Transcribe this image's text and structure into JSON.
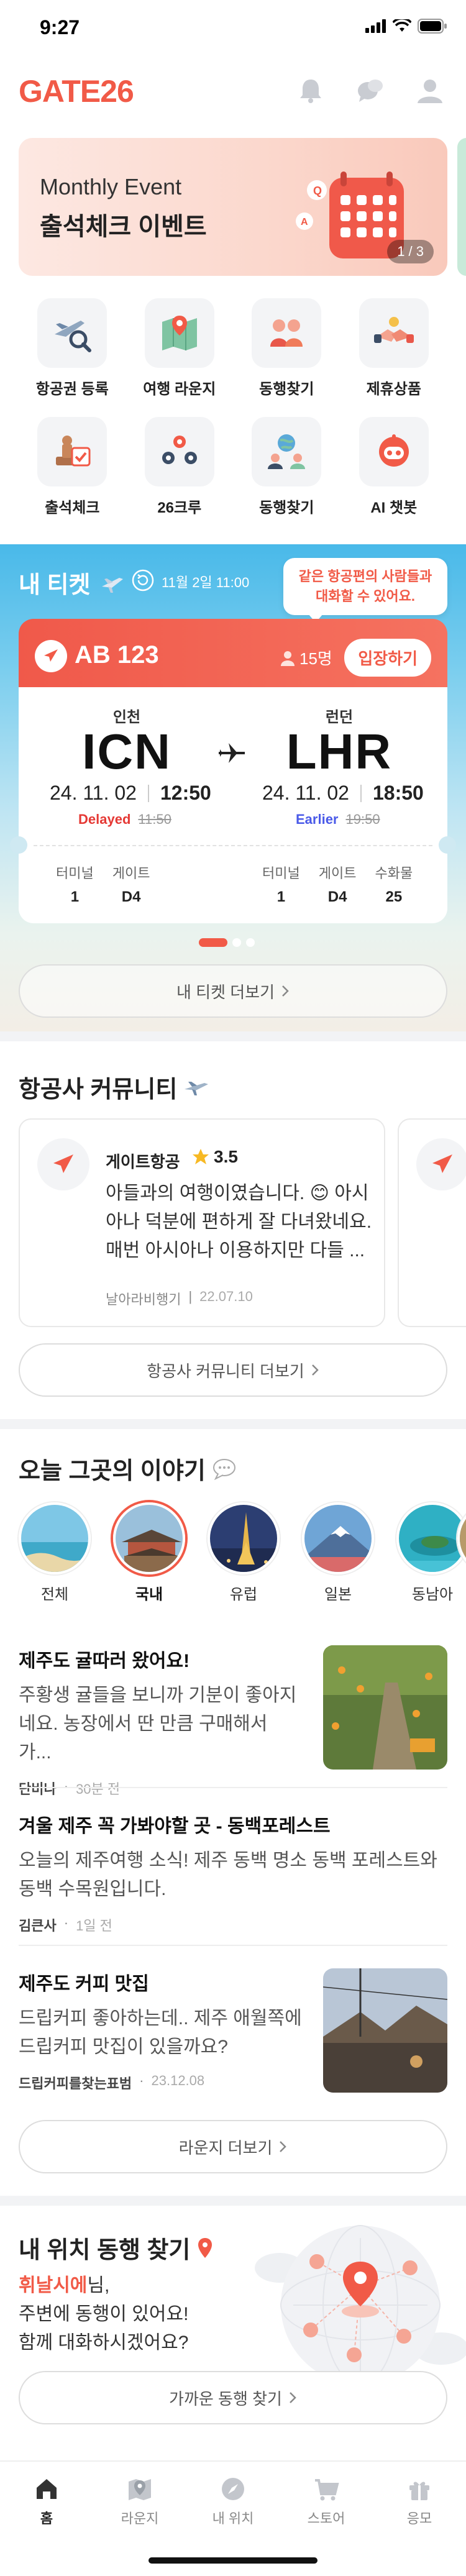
{
  "status_bar": {
    "time": "9:27"
  },
  "header": {
    "logo": "GATE26",
    "icons": [
      "bell-icon",
      "chat-icon",
      "profile-icon"
    ]
  },
  "banner": {
    "subtitle": "Monthly Event",
    "title": "출석체크 이벤트",
    "page": "1 / 3"
  },
  "quick_menu": [
    {
      "label": "항공권 등록",
      "icon": "plane-search-icon"
    },
    {
      "label": "여행 라운지",
      "icon": "map-icon"
    },
    {
      "label": "동행찾기",
      "icon": "people-icon"
    },
    {
      "label": "제휴상품",
      "icon": "handshake-icon"
    },
    {
      "label": "출석체크",
      "icon": "stamp-icon"
    },
    {
      "label": "26크루",
      "icon": "crew-icon"
    },
    {
      "label": "동행찾기",
      "icon": "globe-people-icon"
    },
    {
      "label": "AI 챗봇",
      "icon": "ai-chatbot-icon"
    }
  ],
  "ticket_section": {
    "title": "내 티켓",
    "updated": "11월 2일 11:00",
    "bubble": "같은 항공편의 사람들과 대화할 수 있어요.",
    "flight": "AB 123",
    "people": "15명",
    "enter_button": "입장하기",
    "departure": {
      "city": "인천",
      "code": "ICN",
      "date": "24. 11. 02",
      "time": "12:50",
      "status": "Delayed",
      "old_time": "11:50",
      "terminal_label": "터미널",
      "terminal": "1",
      "gate_label": "게이트",
      "gate": "D4"
    },
    "arrival": {
      "city": "런던",
      "code": "LHR",
      "date": "24. 11. 02",
      "time": "18:50",
      "status": "Earlier",
      "old_time": "19:50",
      "terminal_label": "터미널",
      "terminal": "1",
      "gate_label": "게이트",
      "gate": "D4",
      "baggage_label": "수화물",
      "baggage": "25"
    },
    "more_button": "내 티켓 더보기"
  },
  "community": {
    "title": "항공사 커뮤니티",
    "card": {
      "name": "게이트항공",
      "rating": "3.5",
      "body": "아들과의 여행이였습니다. 😊 아시아나 덕분에 편하게 잘 다녀왔네요. 매번 아시아나 이용하지만 다들 ...",
      "author": "날아라비행기",
      "date": "22.07.10"
    },
    "more_button": "항공사 커뮤니티 더보기"
  },
  "stories": {
    "title": "오늘 그곳의 이야기",
    "categories": [
      "전체",
      "국내",
      "유럽",
      "일본",
      "동남아"
    ],
    "active_category": "국내",
    "items": [
      {
        "title": "제주도 귤따러 왔어요!",
        "body": "주황생 귤들을 보니까 기분이 좋아지네요. 농장에서 딴 만큼 구매해서 가...",
        "author": "단비나",
        "time": "30분 전",
        "has_thumb": true
      },
      {
        "title": "겨울 제주 꼭 가봐야할 곳 - 동백포레스트",
        "body": "오늘의 제주여행 소식! 제주 동백 명소 동백 포레스트와 동백 수목원입니다.",
        "author": "김큰사",
        "time": "1일 전",
        "has_thumb": false
      },
      {
        "title": "제주도 커피 맛집",
        "body": "드립커피 좋아하는데.. 제주 애월쪽에 드립커피 맛집이 있을까요?",
        "author": "드립커피를찾는표범",
        "time": "23.12.08",
        "has_thumb": true
      }
    ],
    "more_button": "라운지 더보기"
  },
  "location": {
    "title": "내 위치 동행 찾기",
    "nickname": "휘날시에",
    "nick_suffix": "님,",
    "line2": "주변에 동행이 있어요!",
    "line3": "함께 대화하시겠어요?",
    "more_button": "가까운 동행 찾기"
  },
  "bottom_nav": [
    {
      "label": "홈",
      "icon": "home-icon",
      "active": true
    },
    {
      "label": "라운지",
      "icon": "lounge-map-icon",
      "active": false
    },
    {
      "label": "내 위치",
      "icon": "compass-icon",
      "active": false
    },
    {
      "label": "스토어",
      "icon": "cart-icon",
      "active": false
    },
    {
      "label": "응모",
      "icon": "gift-icon",
      "active": false
    }
  ],
  "colors": {
    "brand": "#f15a47",
    "ticket_sky": "#49b9e9",
    "delayed": "#e53935",
    "earlier": "#4a5ae8"
  }
}
